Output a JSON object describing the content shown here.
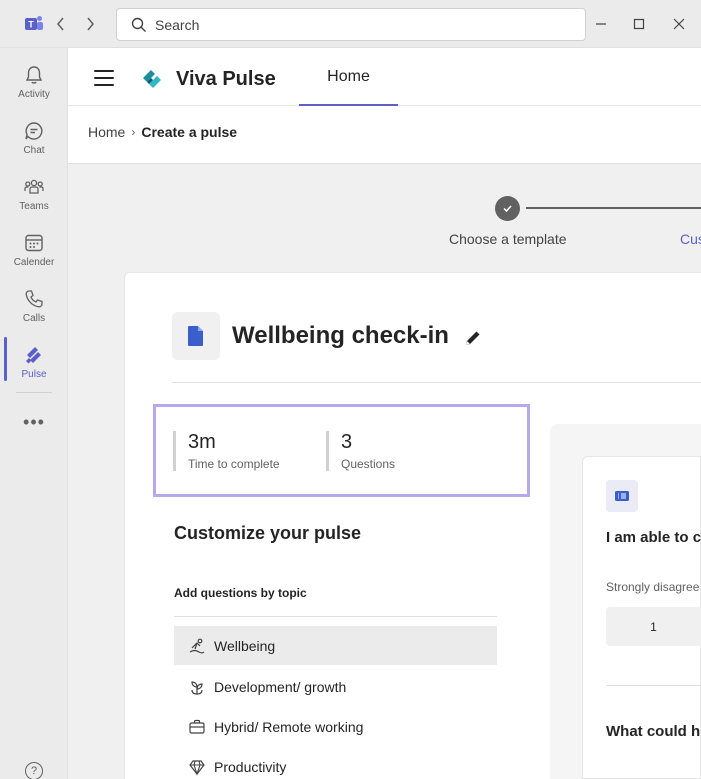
{
  "titlebar": {
    "search_placeholder": "Search"
  },
  "rail": {
    "items": [
      {
        "label": "Activity",
        "icon": "bell-icon"
      },
      {
        "label": "Chat",
        "icon": "chat-icon"
      },
      {
        "label": "Teams",
        "icon": "teams-icon"
      },
      {
        "label": "Calender",
        "icon": "calendar-icon"
      },
      {
        "label": "Calls",
        "icon": "phone-icon"
      },
      {
        "label": "Pulse",
        "icon": "pulse-icon"
      }
    ],
    "more": "•••",
    "help": "?"
  },
  "header": {
    "app_title": "Viva Pulse",
    "tab_home": "Home"
  },
  "breadcrumb": {
    "home": "Home",
    "sep": "›",
    "current": "Create a pulse"
  },
  "stepper": {
    "step1": "Choose a template",
    "step2": "Cus"
  },
  "pulse": {
    "title": "Wellbeing check-in",
    "stats": [
      {
        "value": "3m",
        "caption": "Time to complete"
      },
      {
        "value": "3",
        "caption": "Questions"
      }
    ],
    "customize_heading": "Customize your pulse",
    "topics_heading": "Add questions by topic",
    "topics": [
      {
        "label": "Wellbeing",
        "icon": "wellbeing-icon",
        "selected": true
      },
      {
        "label": "Development/ growth",
        "icon": "growth-icon",
        "selected": false
      },
      {
        "label": "Hybrid/ Remote working",
        "icon": "briefcase-icon",
        "selected": false
      },
      {
        "label": "Productivity",
        "icon": "diamond-icon",
        "selected": false
      }
    ]
  },
  "preview": {
    "question1": "I am able to c",
    "scale_label": "Strongly disagree",
    "scale_first": "1",
    "question2": "What could h"
  },
  "colors": {
    "accent": "#5b5fc7",
    "highlight_border": "#b9a7ec"
  }
}
